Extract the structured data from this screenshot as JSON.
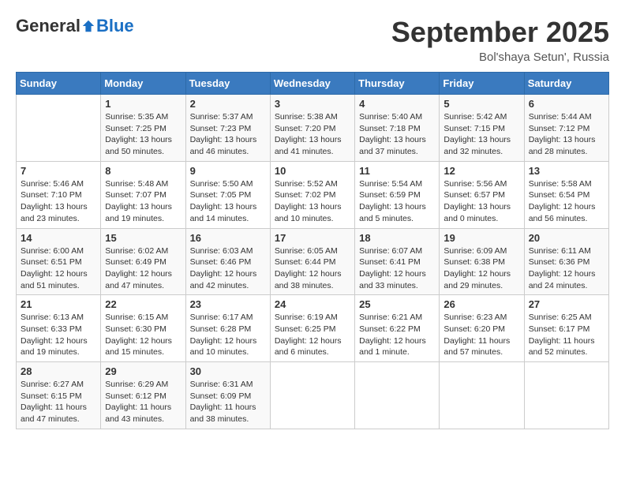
{
  "logo": {
    "general": "General",
    "blue": "Blue"
  },
  "title": "September 2025",
  "location": "Bol'shaya Setun', Russia",
  "weekdays": [
    "Sunday",
    "Monday",
    "Tuesday",
    "Wednesday",
    "Thursday",
    "Friday",
    "Saturday"
  ],
  "weeks": [
    [
      null,
      {
        "day": 1,
        "sunrise": "5:35 AM",
        "sunset": "7:25 PM",
        "daylight": "13 hours and 50 minutes."
      },
      {
        "day": 2,
        "sunrise": "5:37 AM",
        "sunset": "7:23 PM",
        "daylight": "13 hours and 46 minutes."
      },
      {
        "day": 3,
        "sunrise": "5:38 AM",
        "sunset": "7:20 PM",
        "daylight": "13 hours and 41 minutes."
      },
      {
        "day": 4,
        "sunrise": "5:40 AM",
        "sunset": "7:18 PM",
        "daylight": "13 hours and 37 minutes."
      },
      {
        "day": 5,
        "sunrise": "5:42 AM",
        "sunset": "7:15 PM",
        "daylight": "13 hours and 32 minutes."
      },
      {
        "day": 6,
        "sunrise": "5:44 AM",
        "sunset": "7:12 PM",
        "daylight": "13 hours and 28 minutes."
      }
    ],
    [
      {
        "day": 7,
        "sunrise": "5:46 AM",
        "sunset": "7:10 PM",
        "daylight": "13 hours and 23 minutes."
      },
      {
        "day": 8,
        "sunrise": "5:48 AM",
        "sunset": "7:07 PM",
        "daylight": "13 hours and 19 minutes."
      },
      {
        "day": 9,
        "sunrise": "5:50 AM",
        "sunset": "7:05 PM",
        "daylight": "13 hours and 14 minutes."
      },
      {
        "day": 10,
        "sunrise": "5:52 AM",
        "sunset": "7:02 PM",
        "daylight": "13 hours and 10 minutes."
      },
      {
        "day": 11,
        "sunrise": "5:54 AM",
        "sunset": "6:59 PM",
        "daylight": "13 hours and 5 minutes."
      },
      {
        "day": 12,
        "sunrise": "5:56 AM",
        "sunset": "6:57 PM",
        "daylight": "13 hours and 0 minutes."
      },
      {
        "day": 13,
        "sunrise": "5:58 AM",
        "sunset": "6:54 PM",
        "daylight": "12 hours and 56 minutes."
      }
    ],
    [
      {
        "day": 14,
        "sunrise": "6:00 AM",
        "sunset": "6:51 PM",
        "daylight": "12 hours and 51 minutes."
      },
      {
        "day": 15,
        "sunrise": "6:02 AM",
        "sunset": "6:49 PM",
        "daylight": "12 hours and 47 minutes."
      },
      {
        "day": 16,
        "sunrise": "6:03 AM",
        "sunset": "6:46 PM",
        "daylight": "12 hours and 42 minutes."
      },
      {
        "day": 17,
        "sunrise": "6:05 AM",
        "sunset": "6:44 PM",
        "daylight": "12 hours and 38 minutes."
      },
      {
        "day": 18,
        "sunrise": "6:07 AM",
        "sunset": "6:41 PM",
        "daylight": "12 hours and 33 minutes."
      },
      {
        "day": 19,
        "sunrise": "6:09 AM",
        "sunset": "6:38 PM",
        "daylight": "12 hours and 29 minutes."
      },
      {
        "day": 20,
        "sunrise": "6:11 AM",
        "sunset": "6:36 PM",
        "daylight": "12 hours and 24 minutes."
      }
    ],
    [
      {
        "day": 21,
        "sunrise": "6:13 AM",
        "sunset": "6:33 PM",
        "daylight": "12 hours and 19 minutes."
      },
      {
        "day": 22,
        "sunrise": "6:15 AM",
        "sunset": "6:30 PM",
        "daylight": "12 hours and 15 minutes."
      },
      {
        "day": 23,
        "sunrise": "6:17 AM",
        "sunset": "6:28 PM",
        "daylight": "12 hours and 10 minutes."
      },
      {
        "day": 24,
        "sunrise": "6:19 AM",
        "sunset": "6:25 PM",
        "daylight": "12 hours and 6 minutes."
      },
      {
        "day": 25,
        "sunrise": "6:21 AM",
        "sunset": "6:22 PM",
        "daylight": "12 hours and 1 minute."
      },
      {
        "day": 26,
        "sunrise": "6:23 AM",
        "sunset": "6:20 PM",
        "daylight": "11 hours and 57 minutes."
      },
      {
        "day": 27,
        "sunrise": "6:25 AM",
        "sunset": "6:17 PM",
        "daylight": "11 hours and 52 minutes."
      }
    ],
    [
      {
        "day": 28,
        "sunrise": "6:27 AM",
        "sunset": "6:15 PM",
        "daylight": "11 hours and 47 minutes."
      },
      {
        "day": 29,
        "sunrise": "6:29 AM",
        "sunset": "6:12 PM",
        "daylight": "11 hours and 43 minutes."
      },
      {
        "day": 30,
        "sunrise": "6:31 AM",
        "sunset": "6:09 PM",
        "daylight": "11 hours and 38 minutes."
      },
      null,
      null,
      null,
      null
    ]
  ]
}
